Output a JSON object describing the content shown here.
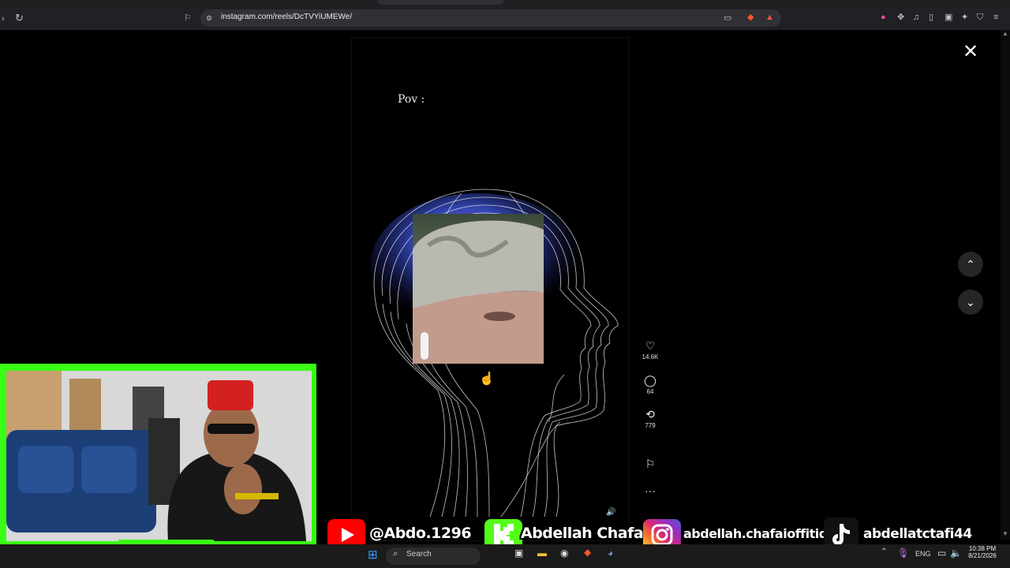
{
  "browser": {
    "url": "instagram.com/reels/DcTVYiUMEWe/",
    "icons": [
      "back-icon",
      "reload-icon",
      "bookmark-icon",
      "site-info-icon",
      "cast-icon",
      "brave-shield-icon",
      "rewards-icon",
      "extension-icon",
      "puzzle-icon",
      "media-icon",
      "sidebar-icon",
      "wallet-icon",
      "leo-icon",
      "vpn-icon",
      "menu-icon"
    ]
  },
  "reel": {
    "overlay_text": "Pov :",
    "likes": "14.6K",
    "comments": "64",
    "reposts": "779"
  },
  "controls": {
    "close_glyph": "✕",
    "up_glyph": "⌃",
    "down_glyph": "⌄"
  },
  "social": {
    "youtube": "@Abdo.1296",
    "kick": "Abdellah Chafai",
    "instagram": "abdellah.chafaioffitid",
    "tiktok": "abdellatctafi44"
  },
  "taskbar": {
    "search_label": "Search",
    "language": "ENG",
    "time": "10:38 PM",
    "date": "8/21/2026"
  },
  "colors": {
    "overlay_green": "#39ff14",
    "youtube_red": "#ff0000",
    "kick_green": "#53fc18"
  }
}
